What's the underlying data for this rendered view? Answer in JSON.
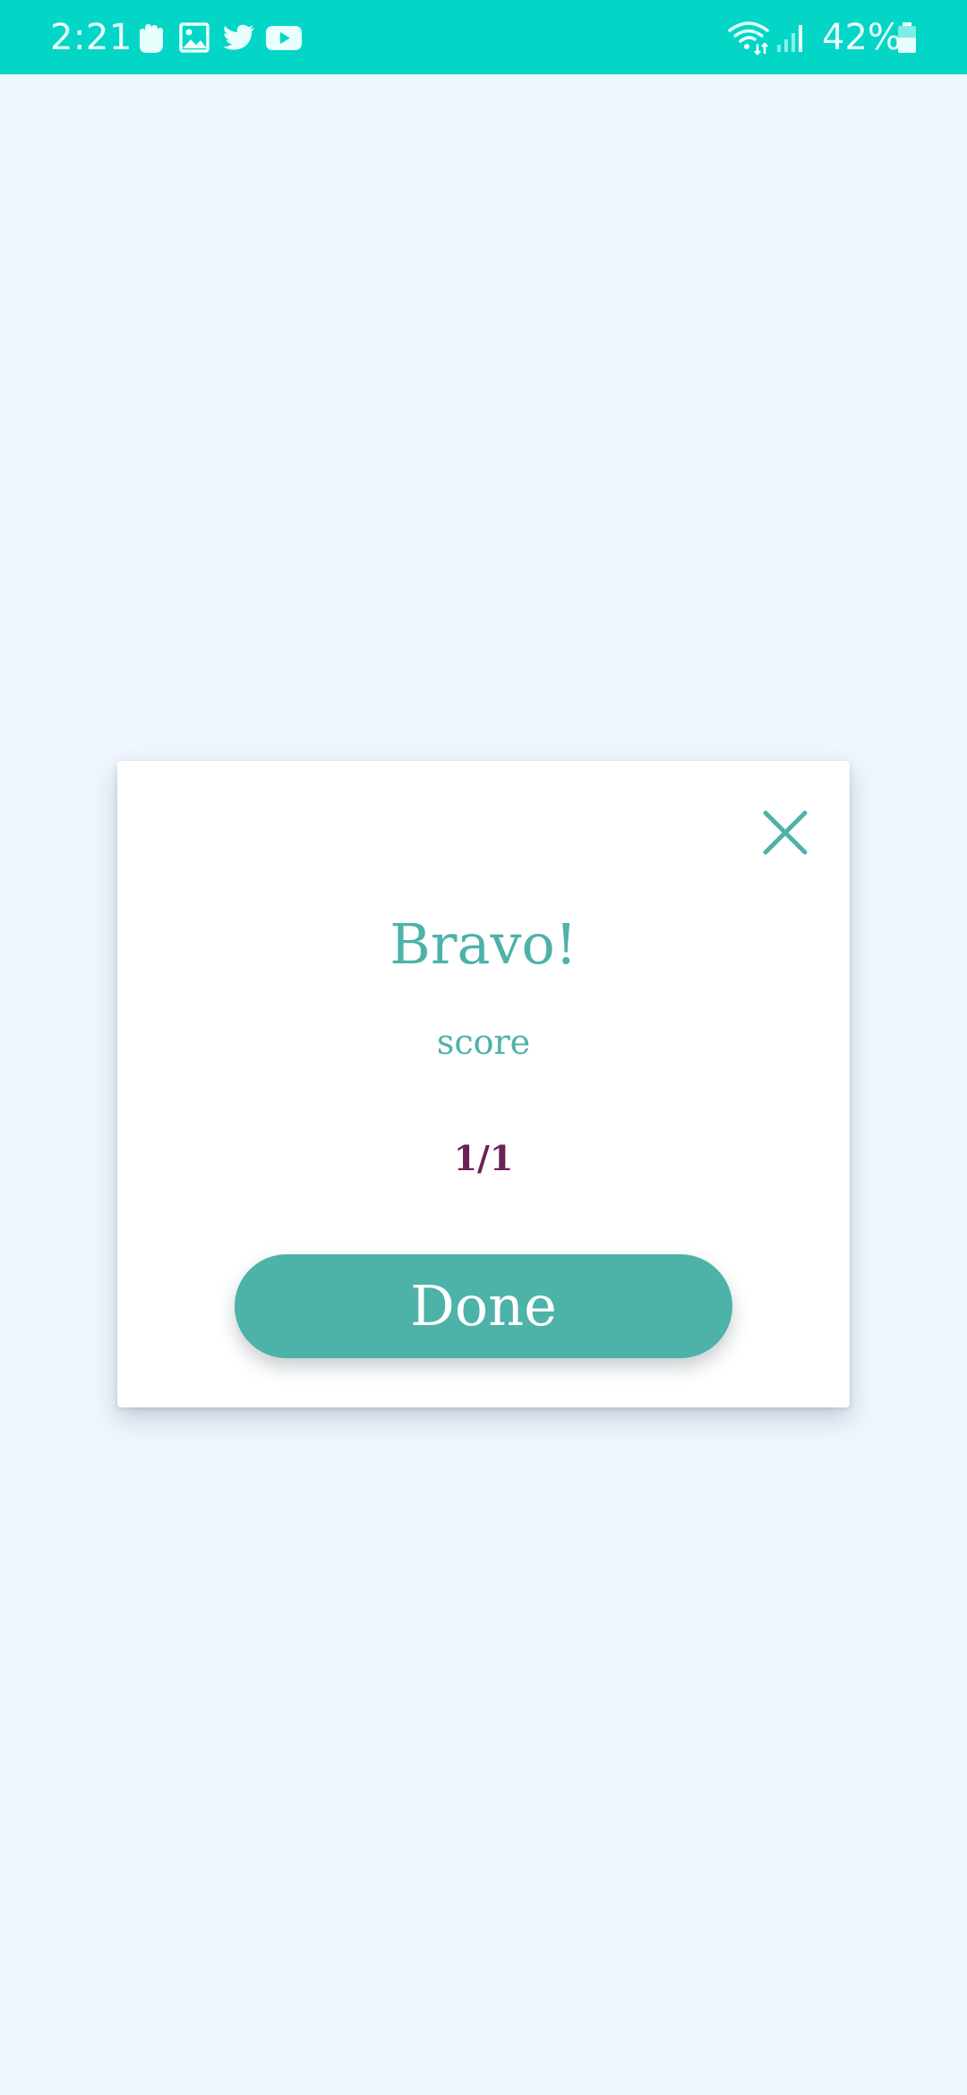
{
  "status_bar": {
    "time": "2:21",
    "battery_percent": "42%",
    "background_color": "#03d6c6",
    "left_icons": [
      "hand-icon",
      "image-icon",
      "twitter-icon",
      "youtube-icon"
    ],
    "right_icons": [
      "wifi-icon",
      "signal-icon",
      "battery-icon"
    ]
  },
  "dialog": {
    "title": "Bravo!",
    "score_label": "score",
    "score_value": "1/1",
    "done_label": "Done",
    "close_icon": "close-icon",
    "accent_color": "#4db2a8",
    "score_color": "#6b2258"
  }
}
